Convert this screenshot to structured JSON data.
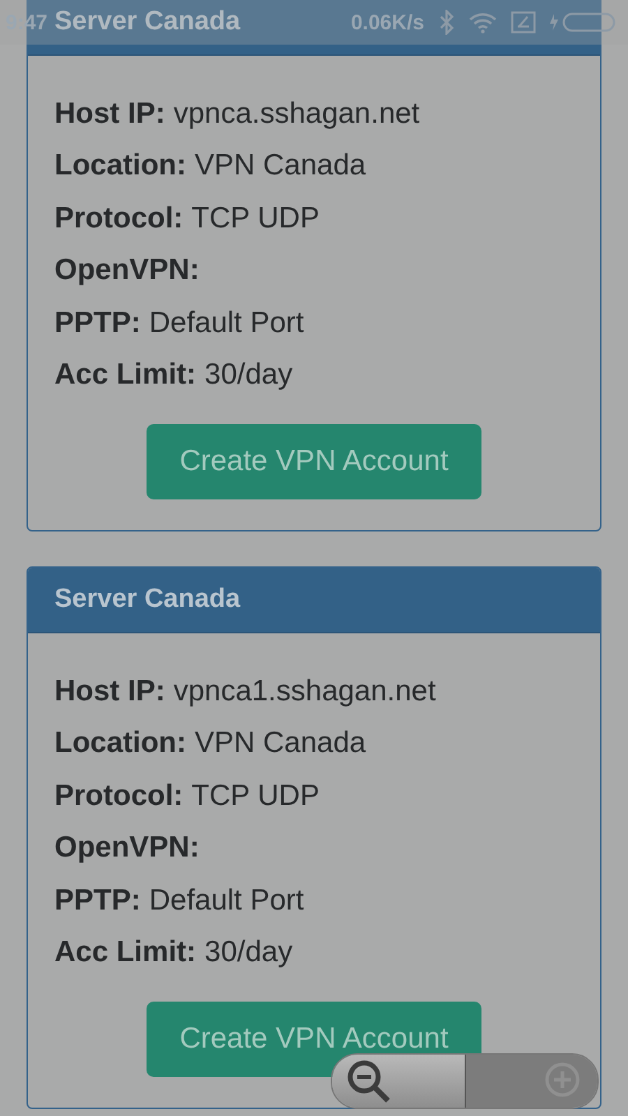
{
  "status_bar": {
    "time": "9:47",
    "speed": "0.06K/s"
  },
  "servers": [
    {
      "title": "Server Canada",
      "fields": [
        {
          "label": "Host IP:",
          "value": "vpnca.sshagan.net"
        },
        {
          "label": "Location:",
          "value": "VPN Canada"
        },
        {
          "label": "Protocol:",
          "value": "TCP UDP"
        },
        {
          "label": "OpenVPN:"
        },
        {
          "label": "PPTP:",
          "value": "Default Port"
        },
        {
          "label": "Acc Limit:",
          "value": "30/day"
        }
      ],
      "button": "Create VPN Account"
    },
    {
      "title": "Server Canada",
      "fields": [
        {
          "label": "Host IP:",
          "value": "vpnca1.sshagan.net"
        },
        {
          "label": "Location:",
          "value": "VPN Canada"
        },
        {
          "label": "Protocol:",
          "value": "TCP UDP"
        },
        {
          "label": "OpenVPN:"
        },
        {
          "label": "PPTP:",
          "value": "Default Port"
        },
        {
          "label": "Acc Limit:",
          "value": "30/day"
        }
      ],
      "button": "Create VPN Account"
    }
  ]
}
